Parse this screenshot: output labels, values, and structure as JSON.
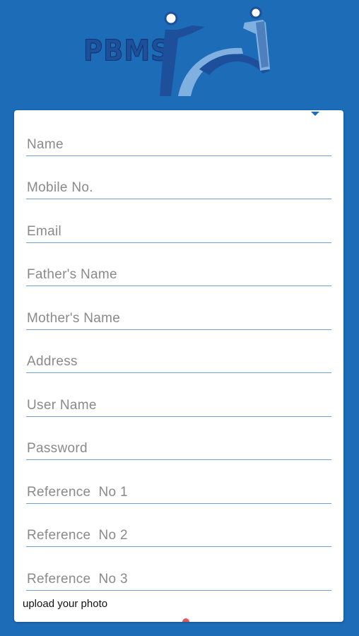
{
  "logo": {
    "text": "PBMS"
  },
  "form": {
    "fields": [
      {
        "placeholder": "Name",
        "value": ""
      },
      {
        "placeholder": "Mobile No.",
        "value": ""
      },
      {
        "placeholder": "Email",
        "value": ""
      },
      {
        "placeholder": "Father's Name",
        "value": ""
      },
      {
        "placeholder": "Mother's Name",
        "value": ""
      },
      {
        "placeholder": "Address",
        "value": ""
      },
      {
        "placeholder": "User Name",
        "value": ""
      },
      {
        "placeholder": "Password",
        "value": ""
      },
      {
        "placeholder": "Reference  No 1",
        "value": ""
      },
      {
        "placeholder": "Reference  No 2",
        "value": ""
      },
      {
        "placeholder": "Reference  No 3",
        "value": ""
      }
    ],
    "upload_label": "upload your photo"
  },
  "colors": {
    "background": "#1c6cb8",
    "field_underline": "#6f9fd6",
    "logo_dark": "#1d4f9a",
    "logo_light": "#7fb0e0"
  }
}
